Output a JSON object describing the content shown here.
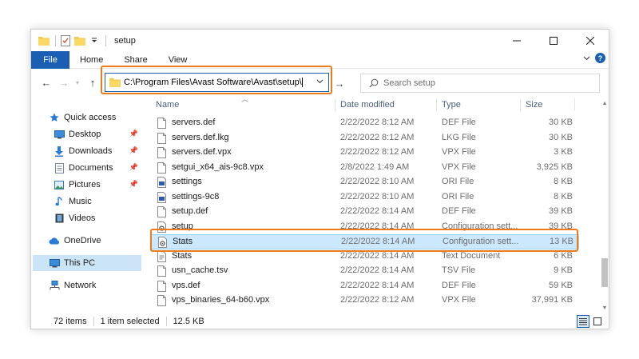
{
  "window": {
    "title": "setup",
    "controls": {
      "minimize": "—",
      "maximize": "☐",
      "close": "✕"
    }
  },
  "ribbon": {
    "tabs": [
      "File",
      "Home",
      "Share",
      "View"
    ],
    "help": "?"
  },
  "navbar": {
    "address": "C:\\Program Files\\Avast Software\\Avast\\setup\\",
    "search_placeholder": "Search setup"
  },
  "sidebar": {
    "items": [
      {
        "label": "Quick access",
        "icon": "star-icon",
        "pinned": false
      },
      {
        "label": "Desktop",
        "icon": "desktop-icon",
        "pinned": true
      },
      {
        "label": "Downloads",
        "icon": "download-icon",
        "pinned": true
      },
      {
        "label": "Documents",
        "icon": "documents-icon",
        "pinned": true
      },
      {
        "label": "Pictures",
        "icon": "pictures-icon",
        "pinned": true
      },
      {
        "label": "Music",
        "icon": "music-icon",
        "pinned": false
      },
      {
        "label": "Videos",
        "icon": "videos-icon",
        "pinned": false
      },
      {
        "label": "OneDrive",
        "icon": "cloud-icon",
        "pinned": false
      },
      {
        "label": "This PC",
        "icon": "computer-icon",
        "pinned": false
      },
      {
        "label": "Network",
        "icon": "network-icon",
        "pinned": false
      }
    ]
  },
  "filelist": {
    "columns": {
      "name": "Name",
      "date": "Date modified",
      "type": "Type",
      "size": "Size"
    },
    "rows": [
      {
        "name": "servers.def",
        "date": "2/22/2022 8:12 AM",
        "type": "DEF File",
        "size": "30 KB",
        "icon": "file-icon"
      },
      {
        "name": "servers.def.lkg",
        "date": "2/22/2022 8:12 AM",
        "type": "LKG File",
        "size": "30 KB",
        "icon": "file-icon"
      },
      {
        "name": "servers.def.vpx",
        "date": "2/22/2022 8:12 AM",
        "type": "VPX File",
        "size": "3 KB",
        "icon": "file-icon"
      },
      {
        "name": "setgui_x64_ais-9c8.vpx",
        "date": "2/8/2022 1:49 AM",
        "type": "VPX File",
        "size": "3,925 KB",
        "icon": "file-icon"
      },
      {
        "name": "settings",
        "date": "2/22/2022 8:10 AM",
        "type": "ORI File",
        "size": "8 KB",
        "icon": "settings-file-icon"
      },
      {
        "name": "settings-9c8",
        "date": "2/22/2022 8:10 AM",
        "type": "ORI File",
        "size": "8 KB",
        "icon": "settings-file-icon"
      },
      {
        "name": "setup.def",
        "date": "2/22/2022 8:14 AM",
        "type": "DEF File",
        "size": "39 KB",
        "icon": "file-icon"
      },
      {
        "name": "setup",
        "date": "2/22/2022 8:14 AM",
        "type": "Configuration sett...",
        "size": "39 KB",
        "icon": "config-file-icon"
      },
      {
        "name": "Stats",
        "date": "2/22/2022 8:14 AM",
        "type": "Configuration sett...",
        "size": "13 KB",
        "icon": "config-file-icon",
        "selected": true
      },
      {
        "name": "Stats",
        "date": "2/22/2022 8:14 AM",
        "type": "Text Document",
        "size": "6 KB",
        "icon": "text-file-icon"
      },
      {
        "name": "usn_cache.tsv",
        "date": "2/22/2022 8:14 AM",
        "type": "TSV File",
        "size": "9 KB",
        "icon": "file-icon"
      },
      {
        "name": "vps.def",
        "date": "2/22/2022 8:14 AM",
        "type": "DEF File",
        "size": "59 KB",
        "icon": "file-icon"
      },
      {
        "name": "vps_binaries_64-b60.vpx",
        "date": "2/22/2022 8:12 AM",
        "type": "VPX File",
        "size": "37,991 KB",
        "icon": "file-icon"
      }
    ]
  },
  "statusbar": {
    "item_count": "72 items",
    "selection": "1 item selected",
    "size": "12.5 KB"
  },
  "colors": {
    "accent": "#1a5fb4",
    "highlight": "#ec7c1a",
    "selected_row": "#cce8ff"
  }
}
